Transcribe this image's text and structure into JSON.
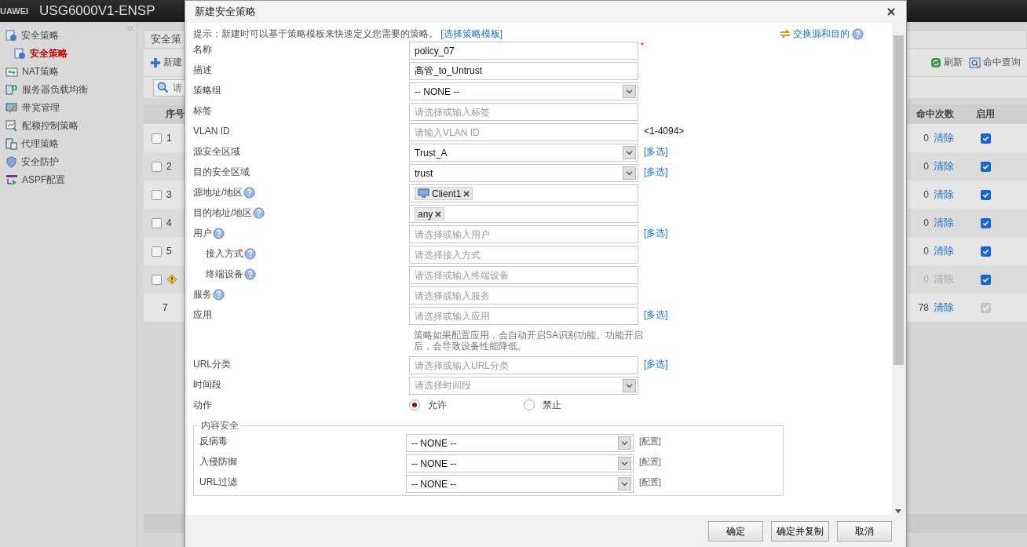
{
  "app_header": {
    "brand": "UAWEI",
    "title": "USG6000V1-ENSP"
  },
  "sidebar": {
    "items": [
      {
        "label": "安全策略",
        "selected": false,
        "children": [
          {
            "label": "安全策略",
            "selected": true
          }
        ]
      },
      {
        "label": "NAT策略",
        "selected": false
      },
      {
        "label": "服务器负载均衡",
        "selected": false
      },
      {
        "label": "带宽管理",
        "selected": false
      },
      {
        "label": "配额控制策略",
        "selected": false
      },
      {
        "label": "代理策略",
        "selected": false
      },
      {
        "label": "安全防护",
        "selected": false
      },
      {
        "label": "ASPF配置",
        "selected": false
      }
    ]
  },
  "main": {
    "tab": "安全策",
    "toolbar": {
      "new": "新建",
      "refresh": "刷新",
      "hit_query": "命中查询"
    },
    "search": {
      "placeholder": "请"
    },
    "table": {
      "columns": [
        "序号",
        "命中次数",
        "启用"
      ],
      "rows": [
        {
          "kind": "normal",
          "no": "1",
          "checked": false,
          "hits": "0",
          "clear": "清除",
          "enabled": true
        },
        {
          "kind": "normal",
          "no": "2",
          "checked": false,
          "hits": "0",
          "clear": "清除",
          "enabled": true
        },
        {
          "kind": "normal",
          "no": "3",
          "checked": false,
          "hits": "0",
          "clear": "清除",
          "enabled": true
        },
        {
          "kind": "normal",
          "no": "4",
          "checked": false,
          "hits": "0",
          "clear": "清除",
          "enabled": true
        },
        {
          "kind": "normal",
          "no": "5",
          "checked": false,
          "hits": "0",
          "clear": "清除",
          "enabled": true
        },
        {
          "kind": "warning",
          "checked": false,
          "hits": "0",
          "clear": "清除",
          "enabled": true
        },
        {
          "kind": "default",
          "no": "7",
          "hits": "78",
          "clear": "清除",
          "enabled": true
        }
      ]
    }
  },
  "dialog": {
    "title": "新建安全策略",
    "hint": "提示：新建时可以基于策略模板来快速定义您需要的策略。",
    "template_link": "[选择策略模板]",
    "swap_link": "交换源和目的",
    "fields": [
      {
        "kind": "text",
        "label": "名称",
        "value": "policy_07",
        "required_mark": "*"
      },
      {
        "kind": "text",
        "label": "描述",
        "value": "高管_to_Untrust"
      },
      {
        "kind": "select",
        "label": "策略组",
        "value": "-- NONE --"
      },
      {
        "kind": "text",
        "label": "标签",
        "placeholder": "请选择或输入标签"
      },
      {
        "kind": "text",
        "label": "VLAN ID",
        "placeholder": "请输入VLAN ID",
        "suffix": "<1-4094>"
      },
      {
        "kind": "select",
        "label": "源安全区域",
        "value": "Trust_A",
        "link": "[多选]"
      },
      {
        "kind": "select",
        "label": "目的安全区域",
        "value": "trust",
        "link": "[多选]"
      },
      {
        "kind": "tags",
        "label": "源地址/地区",
        "help": true,
        "tags": [
          {
            "label": "Client1",
            "icon": true
          }
        ]
      },
      {
        "kind": "tags",
        "label": "目的地址/地区",
        "help": true,
        "tags": [
          {
            "label": "any",
            "icon": false
          }
        ]
      },
      {
        "kind": "text",
        "label": "用户",
        "help": true,
        "placeholder": "请选择或输入用户",
        "link": "[多选]"
      },
      {
        "kind": "text",
        "label": "接入方式",
        "help": true,
        "indent": true,
        "placeholder": "请选择接入方式"
      },
      {
        "kind": "text",
        "label": "终端设备",
        "help": true,
        "indent": true,
        "placeholder": "请选择或输入终端设备"
      },
      {
        "kind": "text",
        "label": "服务",
        "help": true,
        "placeholder": "请选择或输入服务"
      },
      {
        "kind": "text",
        "label": "应用",
        "placeholder": "请选择或输入应用",
        "link": "[多选]",
        "note": "策略如果配置应用，会自动开启SA识别功能。功能开启后，会导致设备性能降低。"
      },
      {
        "kind": "text",
        "label": "URL分类",
        "placeholder": "请选择或输入URL分类",
        "link": "[多选]"
      },
      {
        "kind": "select",
        "label": "时间段",
        "placeholder": "请选择时间段"
      },
      {
        "kind": "radio",
        "label": "动作",
        "options": [
          {
            "label": "允许",
            "selected": true
          },
          {
            "label": "禁止",
            "selected": false
          }
        ]
      }
    ],
    "content_security": {
      "legend": "内容安全",
      "rows": [
        {
          "label": "反病毒",
          "value": "-- NONE --",
          "link": "[配置]"
        },
        {
          "label": "入侵防御",
          "value": "-- NONE --",
          "link": "[配置]"
        },
        {
          "label": "URL过滤",
          "value": "-- NONE --",
          "link": "[配置]"
        }
      ]
    },
    "buttons": [
      "确定",
      "确定并复制",
      "取消"
    ]
  }
}
